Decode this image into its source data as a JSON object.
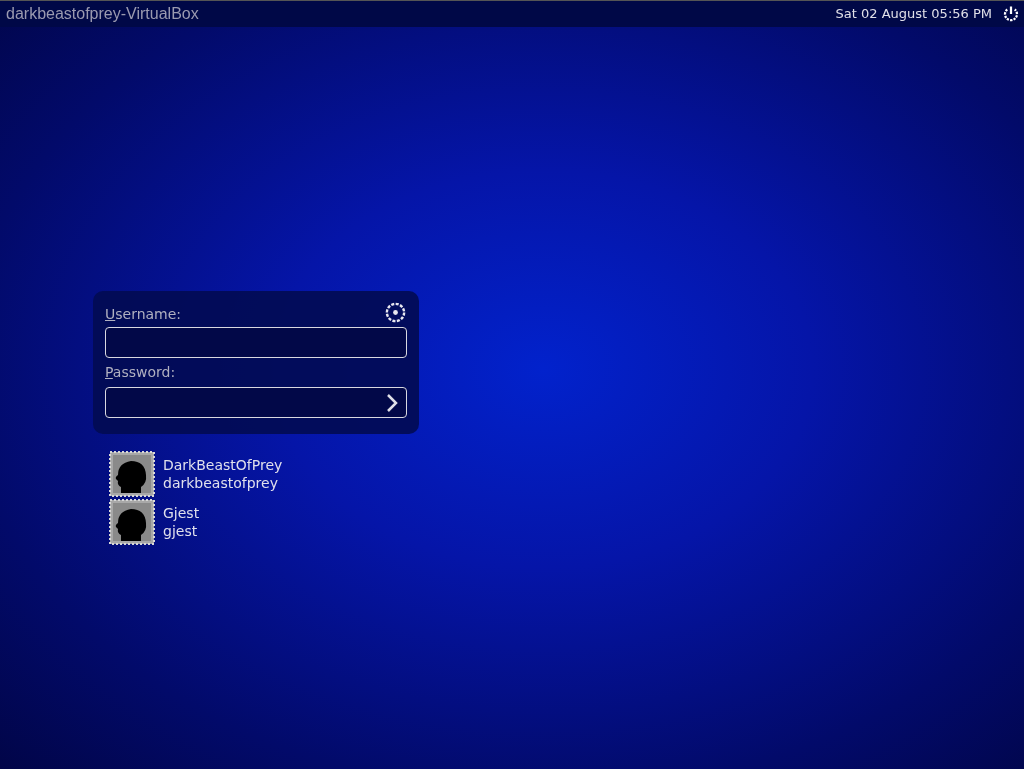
{
  "top_bar": {
    "hostname": "darkbeastofprey-VirtualBox",
    "clock": "Sat 02 August 05:56 PM"
  },
  "login": {
    "username_label": "Username:",
    "password_label": "Password:"
  },
  "users": [
    {
      "display_name": "DarkBeastOfPrey",
      "login_name": "darkbeastofprey"
    },
    {
      "display_name": "Gjest",
      "login_name": "gjest"
    }
  ]
}
